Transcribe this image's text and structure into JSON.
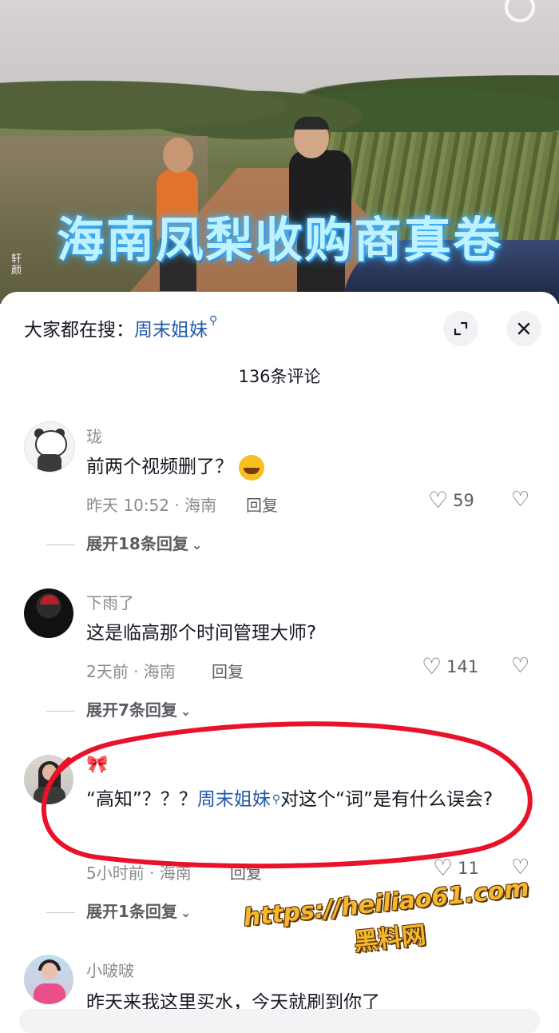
{
  "video": {
    "title": "海南凤梨收购商真卷",
    "watermark": "轩\n颜"
  },
  "header": {
    "search_prefix": "大家都在搜：",
    "search_term": "周末姐妹",
    "expand_icon": "expand-icon",
    "close_icon": "close-icon"
  },
  "comment_count": "136条评论",
  "comments": [
    {
      "user": "珑",
      "text": "前两个视频删了？",
      "emoji": "laughing-crying-emoji",
      "meta": "昨天 10:52 · 海南",
      "reply": "回复",
      "likes": "59",
      "expand": "展开18条回复"
    },
    {
      "user": "下雨了",
      "text": "这是临高那个时间管理大师?",
      "meta": "2天前 · 海南",
      "reply": "回复",
      "likes": "141",
      "expand": "展开7条回复"
    },
    {
      "user": "🎀",
      "text_pre": "“高知”？？？",
      "text_link": "周末姐妹",
      "text_post": "对这个“词”是有什么误会?",
      "meta": "5小时前 · 海南",
      "reply": "回复",
      "likes": "11",
      "expand": "展开1条回复"
    },
    {
      "user": "小啵啵",
      "text": "昨天来我这里买水，今天就刷到你了"
    }
  ],
  "overlay": {
    "url": "https://heiliao61.com",
    "name": "黑料网",
    "annotation_color": "#e8132a"
  },
  "colors": {
    "link": "#235aa6",
    "muted": "#8a8b91",
    "text": "#161823"
  }
}
